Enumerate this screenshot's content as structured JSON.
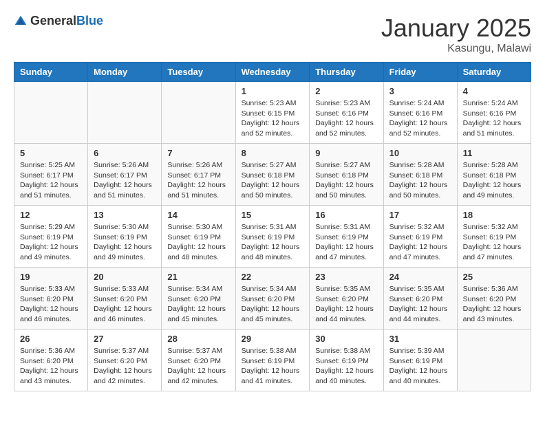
{
  "header": {
    "logo_general": "General",
    "logo_blue": "Blue",
    "month_title": "January 2025",
    "location": "Kasungu, Malawi"
  },
  "days_of_week": [
    "Sunday",
    "Monday",
    "Tuesday",
    "Wednesday",
    "Thursday",
    "Friday",
    "Saturday"
  ],
  "weeks": [
    [
      {
        "day": "",
        "info": ""
      },
      {
        "day": "",
        "info": ""
      },
      {
        "day": "",
        "info": ""
      },
      {
        "day": "1",
        "info": "Sunrise: 5:23 AM\nSunset: 6:15 PM\nDaylight: 12 hours\nand 52 minutes."
      },
      {
        "day": "2",
        "info": "Sunrise: 5:23 AM\nSunset: 6:16 PM\nDaylight: 12 hours\nand 52 minutes."
      },
      {
        "day": "3",
        "info": "Sunrise: 5:24 AM\nSunset: 6:16 PM\nDaylight: 12 hours\nand 52 minutes."
      },
      {
        "day": "4",
        "info": "Sunrise: 5:24 AM\nSunset: 6:16 PM\nDaylight: 12 hours\nand 51 minutes."
      }
    ],
    [
      {
        "day": "5",
        "info": "Sunrise: 5:25 AM\nSunset: 6:17 PM\nDaylight: 12 hours\nand 51 minutes."
      },
      {
        "day": "6",
        "info": "Sunrise: 5:26 AM\nSunset: 6:17 PM\nDaylight: 12 hours\nand 51 minutes."
      },
      {
        "day": "7",
        "info": "Sunrise: 5:26 AM\nSunset: 6:17 PM\nDaylight: 12 hours\nand 51 minutes."
      },
      {
        "day": "8",
        "info": "Sunrise: 5:27 AM\nSunset: 6:18 PM\nDaylight: 12 hours\nand 50 minutes."
      },
      {
        "day": "9",
        "info": "Sunrise: 5:27 AM\nSunset: 6:18 PM\nDaylight: 12 hours\nand 50 minutes."
      },
      {
        "day": "10",
        "info": "Sunrise: 5:28 AM\nSunset: 6:18 PM\nDaylight: 12 hours\nand 50 minutes."
      },
      {
        "day": "11",
        "info": "Sunrise: 5:28 AM\nSunset: 6:18 PM\nDaylight: 12 hours\nand 49 minutes."
      }
    ],
    [
      {
        "day": "12",
        "info": "Sunrise: 5:29 AM\nSunset: 6:19 PM\nDaylight: 12 hours\nand 49 minutes."
      },
      {
        "day": "13",
        "info": "Sunrise: 5:30 AM\nSunset: 6:19 PM\nDaylight: 12 hours\nand 49 minutes."
      },
      {
        "day": "14",
        "info": "Sunrise: 5:30 AM\nSunset: 6:19 PM\nDaylight: 12 hours\nand 48 minutes."
      },
      {
        "day": "15",
        "info": "Sunrise: 5:31 AM\nSunset: 6:19 PM\nDaylight: 12 hours\nand 48 minutes."
      },
      {
        "day": "16",
        "info": "Sunrise: 5:31 AM\nSunset: 6:19 PM\nDaylight: 12 hours\nand 47 minutes."
      },
      {
        "day": "17",
        "info": "Sunrise: 5:32 AM\nSunset: 6:19 PM\nDaylight: 12 hours\nand 47 minutes."
      },
      {
        "day": "18",
        "info": "Sunrise: 5:32 AM\nSunset: 6:19 PM\nDaylight: 12 hours\nand 47 minutes."
      }
    ],
    [
      {
        "day": "19",
        "info": "Sunrise: 5:33 AM\nSunset: 6:20 PM\nDaylight: 12 hours\nand 46 minutes."
      },
      {
        "day": "20",
        "info": "Sunrise: 5:33 AM\nSunset: 6:20 PM\nDaylight: 12 hours\nand 46 minutes."
      },
      {
        "day": "21",
        "info": "Sunrise: 5:34 AM\nSunset: 6:20 PM\nDaylight: 12 hours\nand 45 minutes."
      },
      {
        "day": "22",
        "info": "Sunrise: 5:34 AM\nSunset: 6:20 PM\nDaylight: 12 hours\nand 45 minutes."
      },
      {
        "day": "23",
        "info": "Sunrise: 5:35 AM\nSunset: 6:20 PM\nDaylight: 12 hours\nand 44 minutes."
      },
      {
        "day": "24",
        "info": "Sunrise: 5:35 AM\nSunset: 6:20 PM\nDaylight: 12 hours\nand 44 minutes."
      },
      {
        "day": "25",
        "info": "Sunrise: 5:36 AM\nSunset: 6:20 PM\nDaylight: 12 hours\nand 43 minutes."
      }
    ],
    [
      {
        "day": "26",
        "info": "Sunrise: 5:36 AM\nSunset: 6:20 PM\nDaylight: 12 hours\nand 43 minutes."
      },
      {
        "day": "27",
        "info": "Sunrise: 5:37 AM\nSunset: 6:20 PM\nDaylight: 12 hours\nand 42 minutes."
      },
      {
        "day": "28",
        "info": "Sunrise: 5:37 AM\nSunset: 6:20 PM\nDaylight: 12 hours\nand 42 minutes."
      },
      {
        "day": "29",
        "info": "Sunrise: 5:38 AM\nSunset: 6:19 PM\nDaylight: 12 hours\nand 41 minutes."
      },
      {
        "day": "30",
        "info": "Sunrise: 5:38 AM\nSunset: 6:19 PM\nDaylight: 12 hours\nand 40 minutes."
      },
      {
        "day": "31",
        "info": "Sunrise: 5:39 AM\nSunset: 6:19 PM\nDaylight: 12 hours\nand 40 minutes."
      },
      {
        "day": "",
        "info": ""
      }
    ]
  ]
}
